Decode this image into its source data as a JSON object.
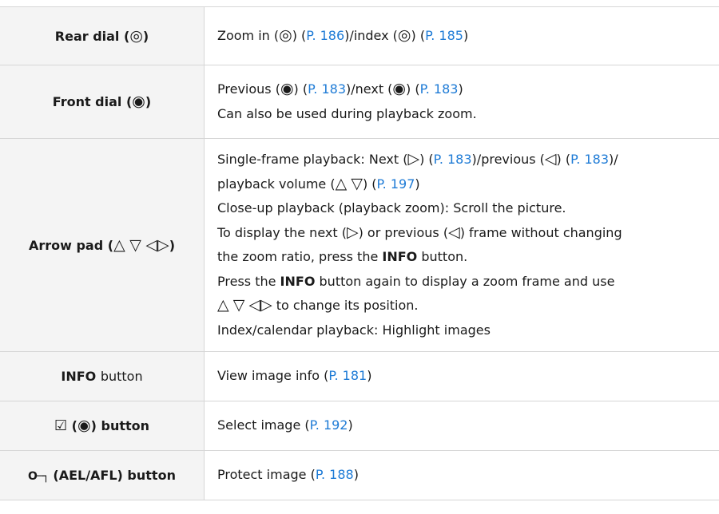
{
  "rows": {
    "rear": {
      "key_label": "Rear dial",
      "desc": {
        "t1": "Zoom in",
        "l1": "P. 186",
        "t2": "/index",
        "l2": "P. 185"
      }
    },
    "front": {
      "key_label": "Front dial",
      "line1": {
        "t1": "Previous",
        "l1": "P. 183",
        "t2": "/next",
        "l2": "P. 183"
      },
      "line2": "Can also be used during playback zoom."
    },
    "arrow": {
      "key_label": "Arrow pad",
      "line1": {
        "t1": "Single-frame playback: Next",
        "l1": "P. 183",
        "t2": "/previous",
        "l2": "P. 183"
      },
      "line2": {
        "t1": "playback volume",
        "l1": "P. 197"
      },
      "line3": "Close-up playback (playback zoom): Scroll the picture.",
      "line4": {
        "t1": "To display the next",
        "t2": "or previous",
        "t3": "frame without changing"
      },
      "line5": {
        "t1": "the zoom ratio, press the",
        "b1": "INFO",
        "t2": "button."
      },
      "line6": {
        "t1": "Press the",
        "b1": "INFO",
        "t2": "button again to display a zoom frame and use"
      },
      "line7": "to change its position.",
      "line8": "Index/calendar playback: Highlight images"
    },
    "info": {
      "key_bold": "INFO",
      "key_rest": "button",
      "desc": {
        "t1": "View image info",
        "l1": "P. 181"
      }
    },
    "select": {
      "key_rest": "button",
      "desc": {
        "t1": "Select image",
        "l1": "P. 192"
      }
    },
    "protect": {
      "key_rest": "(AEL/AFL) button",
      "desc": {
        "t1": "Protect image",
        "l1": "P. 188"
      }
    }
  }
}
